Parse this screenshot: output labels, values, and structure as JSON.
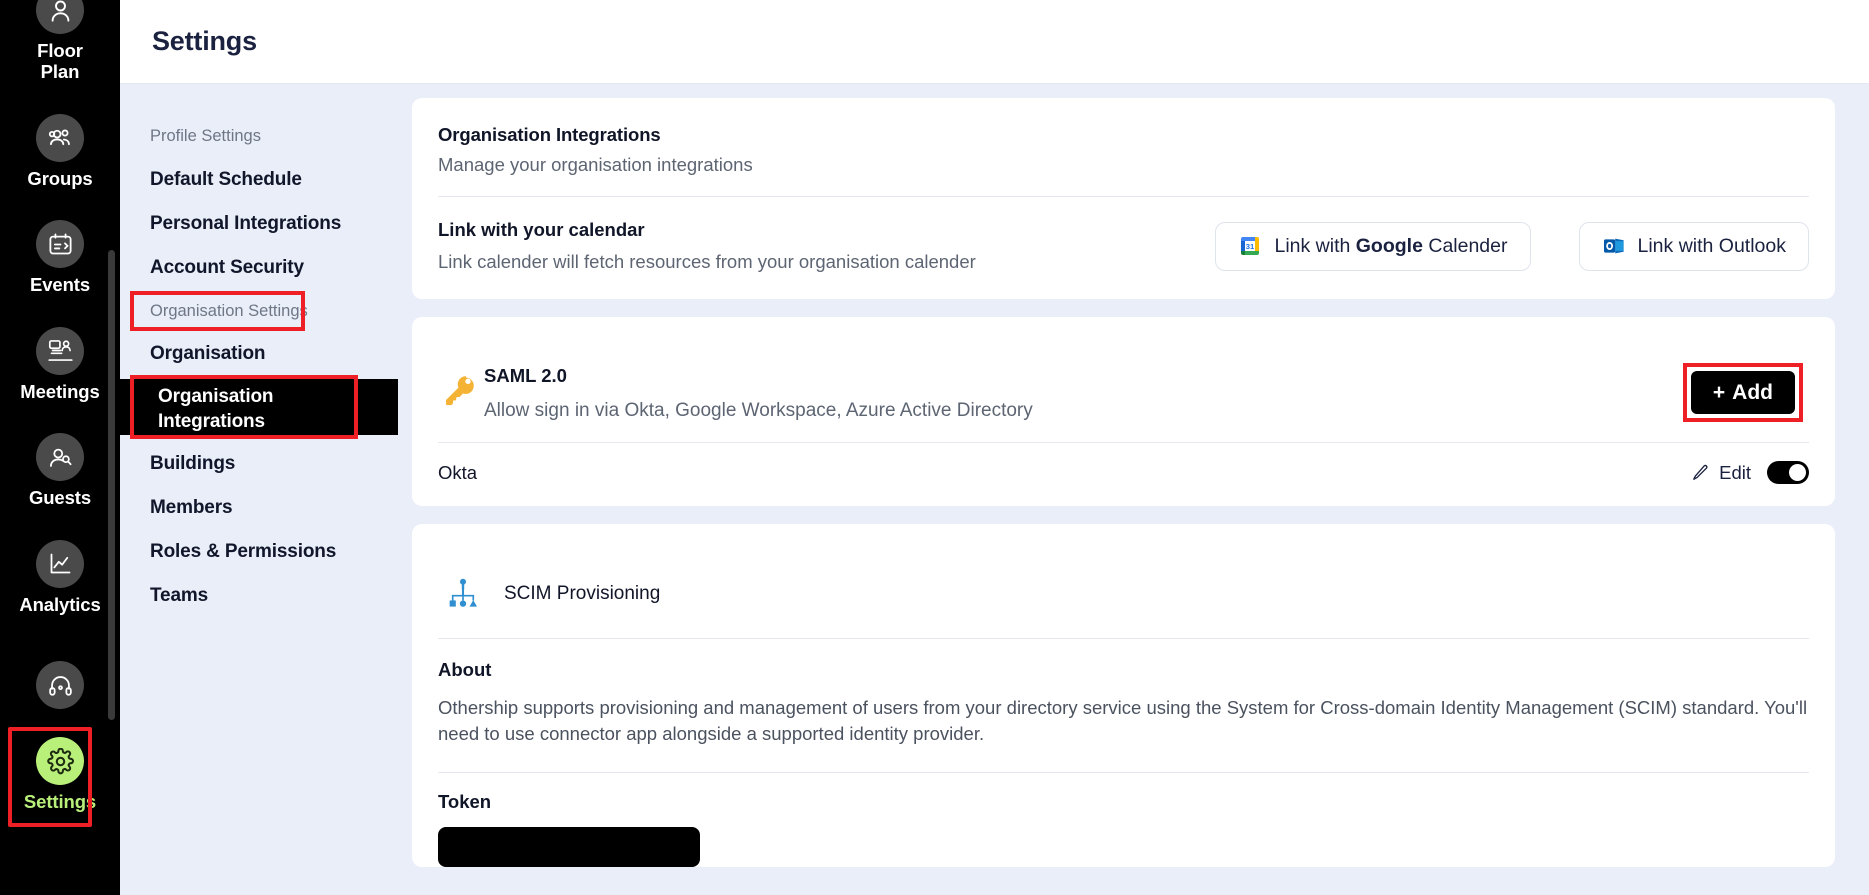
{
  "rail": {
    "items": [
      {
        "label": "Floor\nPlan",
        "label_line1": "Floor",
        "label_line2": "Plan",
        "icon": "user-icon",
        "active": false
      },
      {
        "label": "Groups",
        "icon": "groups-icon",
        "active": false
      },
      {
        "label": "Events",
        "icon": "calendar-events-icon",
        "active": false
      },
      {
        "label": "Meetings",
        "icon": "meetings-icon",
        "active": false
      },
      {
        "label": "Guests",
        "icon": "guest-user-icon",
        "active": false
      },
      {
        "label": "Analytics",
        "icon": "chart-line-icon",
        "active": false
      }
    ],
    "support": {
      "label": "",
      "icon": "headset-support-icon"
    },
    "settings": {
      "label": "Settings",
      "icon": "gear-icon",
      "active": true
    },
    "active_color": "#b9f07a",
    "highlight_color": "#ee2026"
  },
  "header": {
    "title": "Settings"
  },
  "subnav": {
    "group_profile": "Profile Settings",
    "profile_items": [
      {
        "label": "Default Schedule"
      },
      {
        "label": "Personal Integrations"
      },
      {
        "label": "Account Security"
      }
    ],
    "group_org": "Organisation Settings",
    "org_items": [
      {
        "label": "Organisation",
        "active": false
      },
      {
        "label_line1": "Organisation",
        "label_line2": "Integrations",
        "active": true
      },
      {
        "label": "Buildings",
        "active": false
      },
      {
        "label": "Members",
        "active": false
      },
      {
        "label": "Roles & Permissions",
        "active": false
      },
      {
        "label": "Teams",
        "active": false
      }
    ]
  },
  "integrations_card": {
    "title": "Organisation Integrations",
    "subtitle": "Manage your organisation integrations",
    "calendar": {
      "heading": "Link with your calendar",
      "description": "Link calender will fetch resources from your organisation calender",
      "google_button": {
        "prefix": "Link with ",
        "brand": "Google",
        "suffix": " Calender",
        "icon": "google-calendar-icon"
      },
      "outlook_button": {
        "label": "Link with Outlook",
        "icon": "outlook-icon"
      }
    }
  },
  "saml_card": {
    "icon": "key-icon",
    "title": "SAML 2.0",
    "description": "Allow sign in via Okta, Google Workspace, Azure Active Directory",
    "add_button": {
      "plus": "+",
      "label": "Add"
    },
    "provider": {
      "name": "Okta",
      "edit_label": "Edit",
      "edit_icon": "pencil-icon",
      "toggle_state": "on"
    }
  },
  "scim_card": {
    "icon": "org-chart-icon",
    "title": "SCIM Provisioning",
    "about_heading": "About",
    "about_text": "Othership supports provisioning and management of users from your directory service using the System for Cross-domain Identity Management (SCIM) standard. You'll need to use connector app alongside a supported identity provider.",
    "token_heading": "Token",
    "token_value": ""
  }
}
